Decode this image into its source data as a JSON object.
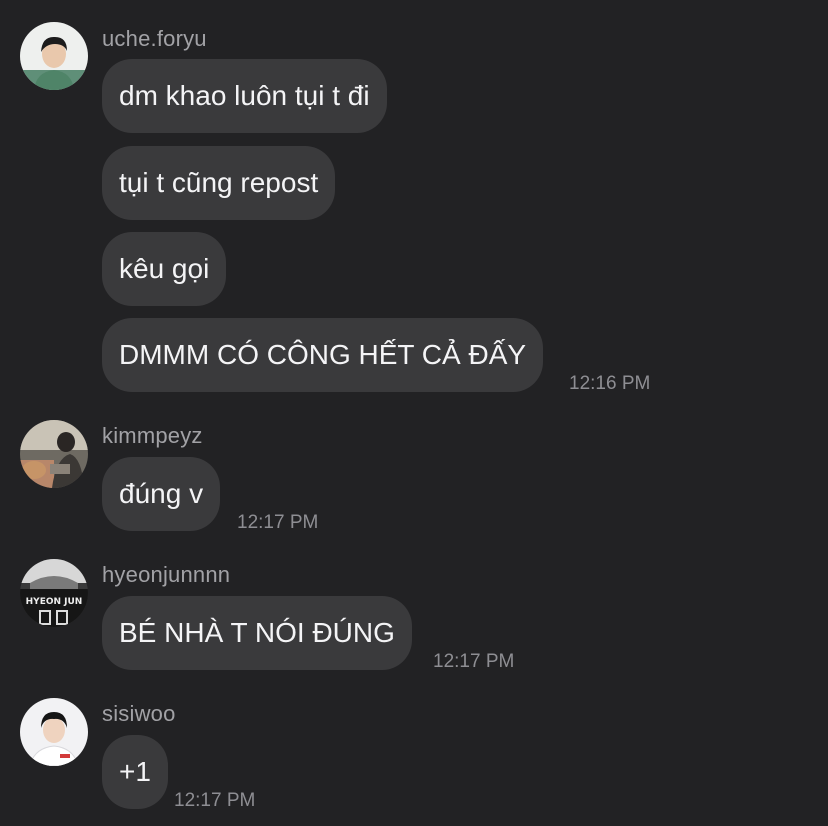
{
  "messages": [
    {
      "username": "uche.foryu",
      "avatar_icon": "avatar-uche-icon",
      "bubbles": [
        "dm khao luôn tụi t đi",
        "tụi t cũng repost",
        "kêu gọi",
        "DMMM CÓ CÔNG HẾT CẢ ĐẤY"
      ],
      "time": "12:16 PM"
    },
    {
      "username": "kimmpeyz",
      "avatar_icon": "avatar-kimmpeyz-icon",
      "bubbles": [
        "đúng v"
      ],
      "time": "12:17 PM"
    },
    {
      "username": "hyeonjunnnn",
      "avatar_icon": "avatar-hyeonjunnnn-icon",
      "avatar_text": "HYEON JUN",
      "bubbles": [
        "BÉ NHÀ T NÓI ĐÚNG"
      ],
      "time": "12:17 PM"
    },
    {
      "username": "sisiwoo",
      "avatar_icon": "avatar-sisiwoo-icon",
      "bubbles": [
        "+1"
      ],
      "time": "12:17 PM"
    }
  ]
}
